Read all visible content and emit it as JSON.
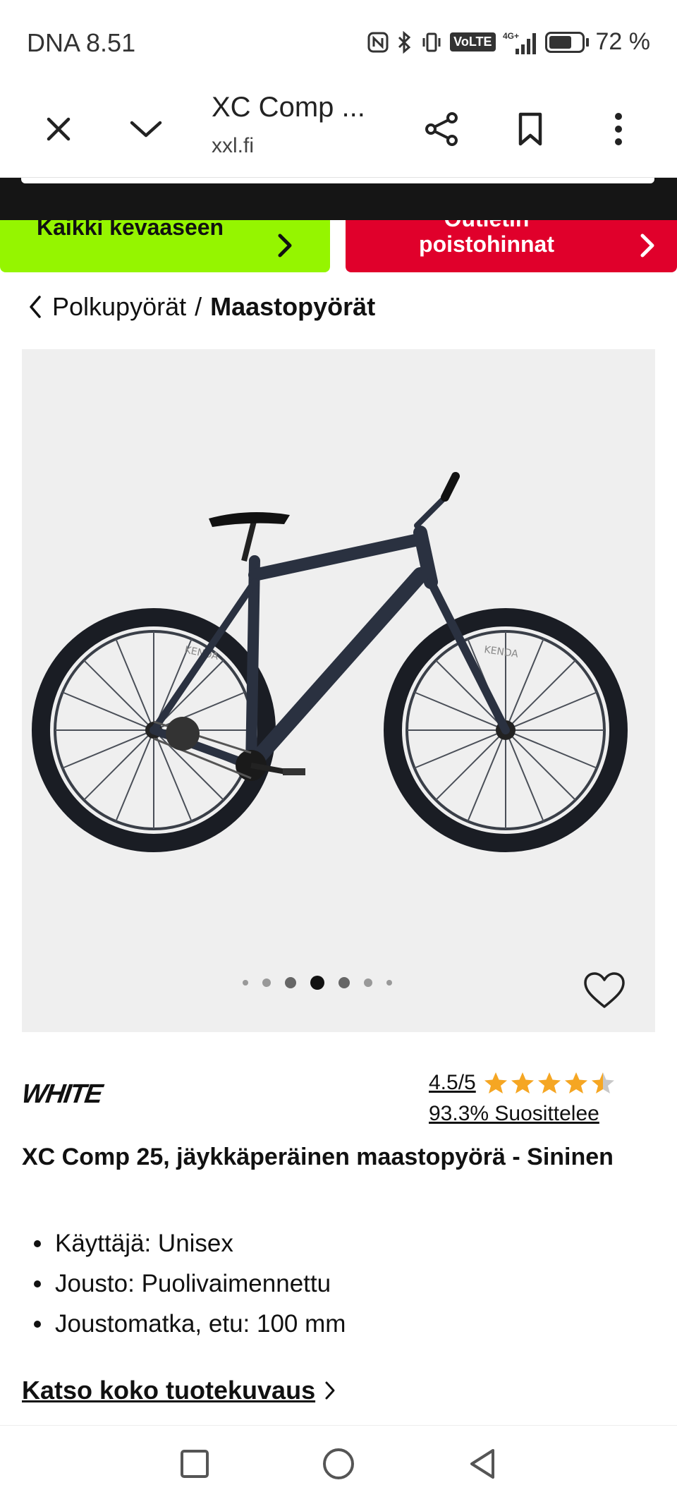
{
  "status_bar": {
    "carrier_time": "DNA 8.51",
    "network": "4G+",
    "volte": "VoLTE",
    "battery_percent": "72 %",
    "battery_level": 0.72
  },
  "browser": {
    "title": "XC Comp ...",
    "url": "xxl.fi"
  },
  "promos": {
    "green_label": "Kaikki kevaaseen",
    "red_label_line1": "Outletin",
    "red_label_line2": "poistohinnat",
    "green_color": "#95f500",
    "red_color": "#e0002b"
  },
  "breadcrumb": {
    "parent": "Polkupyörät",
    "separator": "/",
    "current": "Maastopyörät"
  },
  "product": {
    "brand": "WHITE",
    "rating": "4.5/5",
    "rating_value": 4.5,
    "recommend": "93.3% Suosittelee",
    "title": "XC Comp 25, jäykkäperäinen maastopyörä - Sininen",
    "specs": [
      "Käyttäjä: Unisex",
      "Jousto: Puolivaimennettu",
      "Joustomatka, etu: 100 mm"
    ],
    "description_link": "Katso koko tuotekuvaus",
    "image_count": 7,
    "active_image": 4,
    "tire_brand": "KENDA"
  },
  "colors": {
    "star": "#f5a623",
    "accent_dark": "#151515"
  }
}
